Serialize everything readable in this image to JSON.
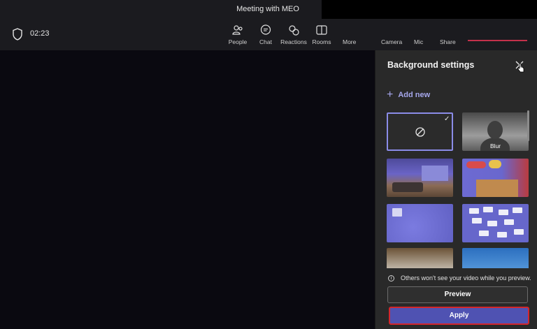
{
  "window": {
    "title": "Meeting with MEO"
  },
  "call": {
    "timer": "02:23"
  },
  "toolbar": {
    "buttons": [
      {
        "label": "People",
        "icon": "people-icon"
      },
      {
        "label": "Chat",
        "icon": "chat-icon"
      },
      {
        "label": "Reactions",
        "icon": "reactions-icon"
      },
      {
        "label": "Rooms",
        "icon": "rooms-icon"
      },
      {
        "label": "More",
        "icon": "more-icon"
      },
      {
        "label": "Camera",
        "icon": "camera-icon"
      },
      {
        "label": "Mic",
        "icon": "mic-icon"
      },
      {
        "label": "Share",
        "icon": "share-icon"
      }
    ]
  },
  "panel": {
    "title": "Background settings",
    "add_new": "Add new",
    "blur_label": "Blur",
    "info_text": "Others won't see your video while you preview.",
    "preview_label": "Preview",
    "apply_label": "Apply",
    "selected_background": "none"
  },
  "colors": {
    "accent": "#4f52b2",
    "accent_text": "#a6a7ec",
    "highlight_border": "#d4262c",
    "panel_bg": "#292929",
    "stage_bg": "#0a0910"
  }
}
